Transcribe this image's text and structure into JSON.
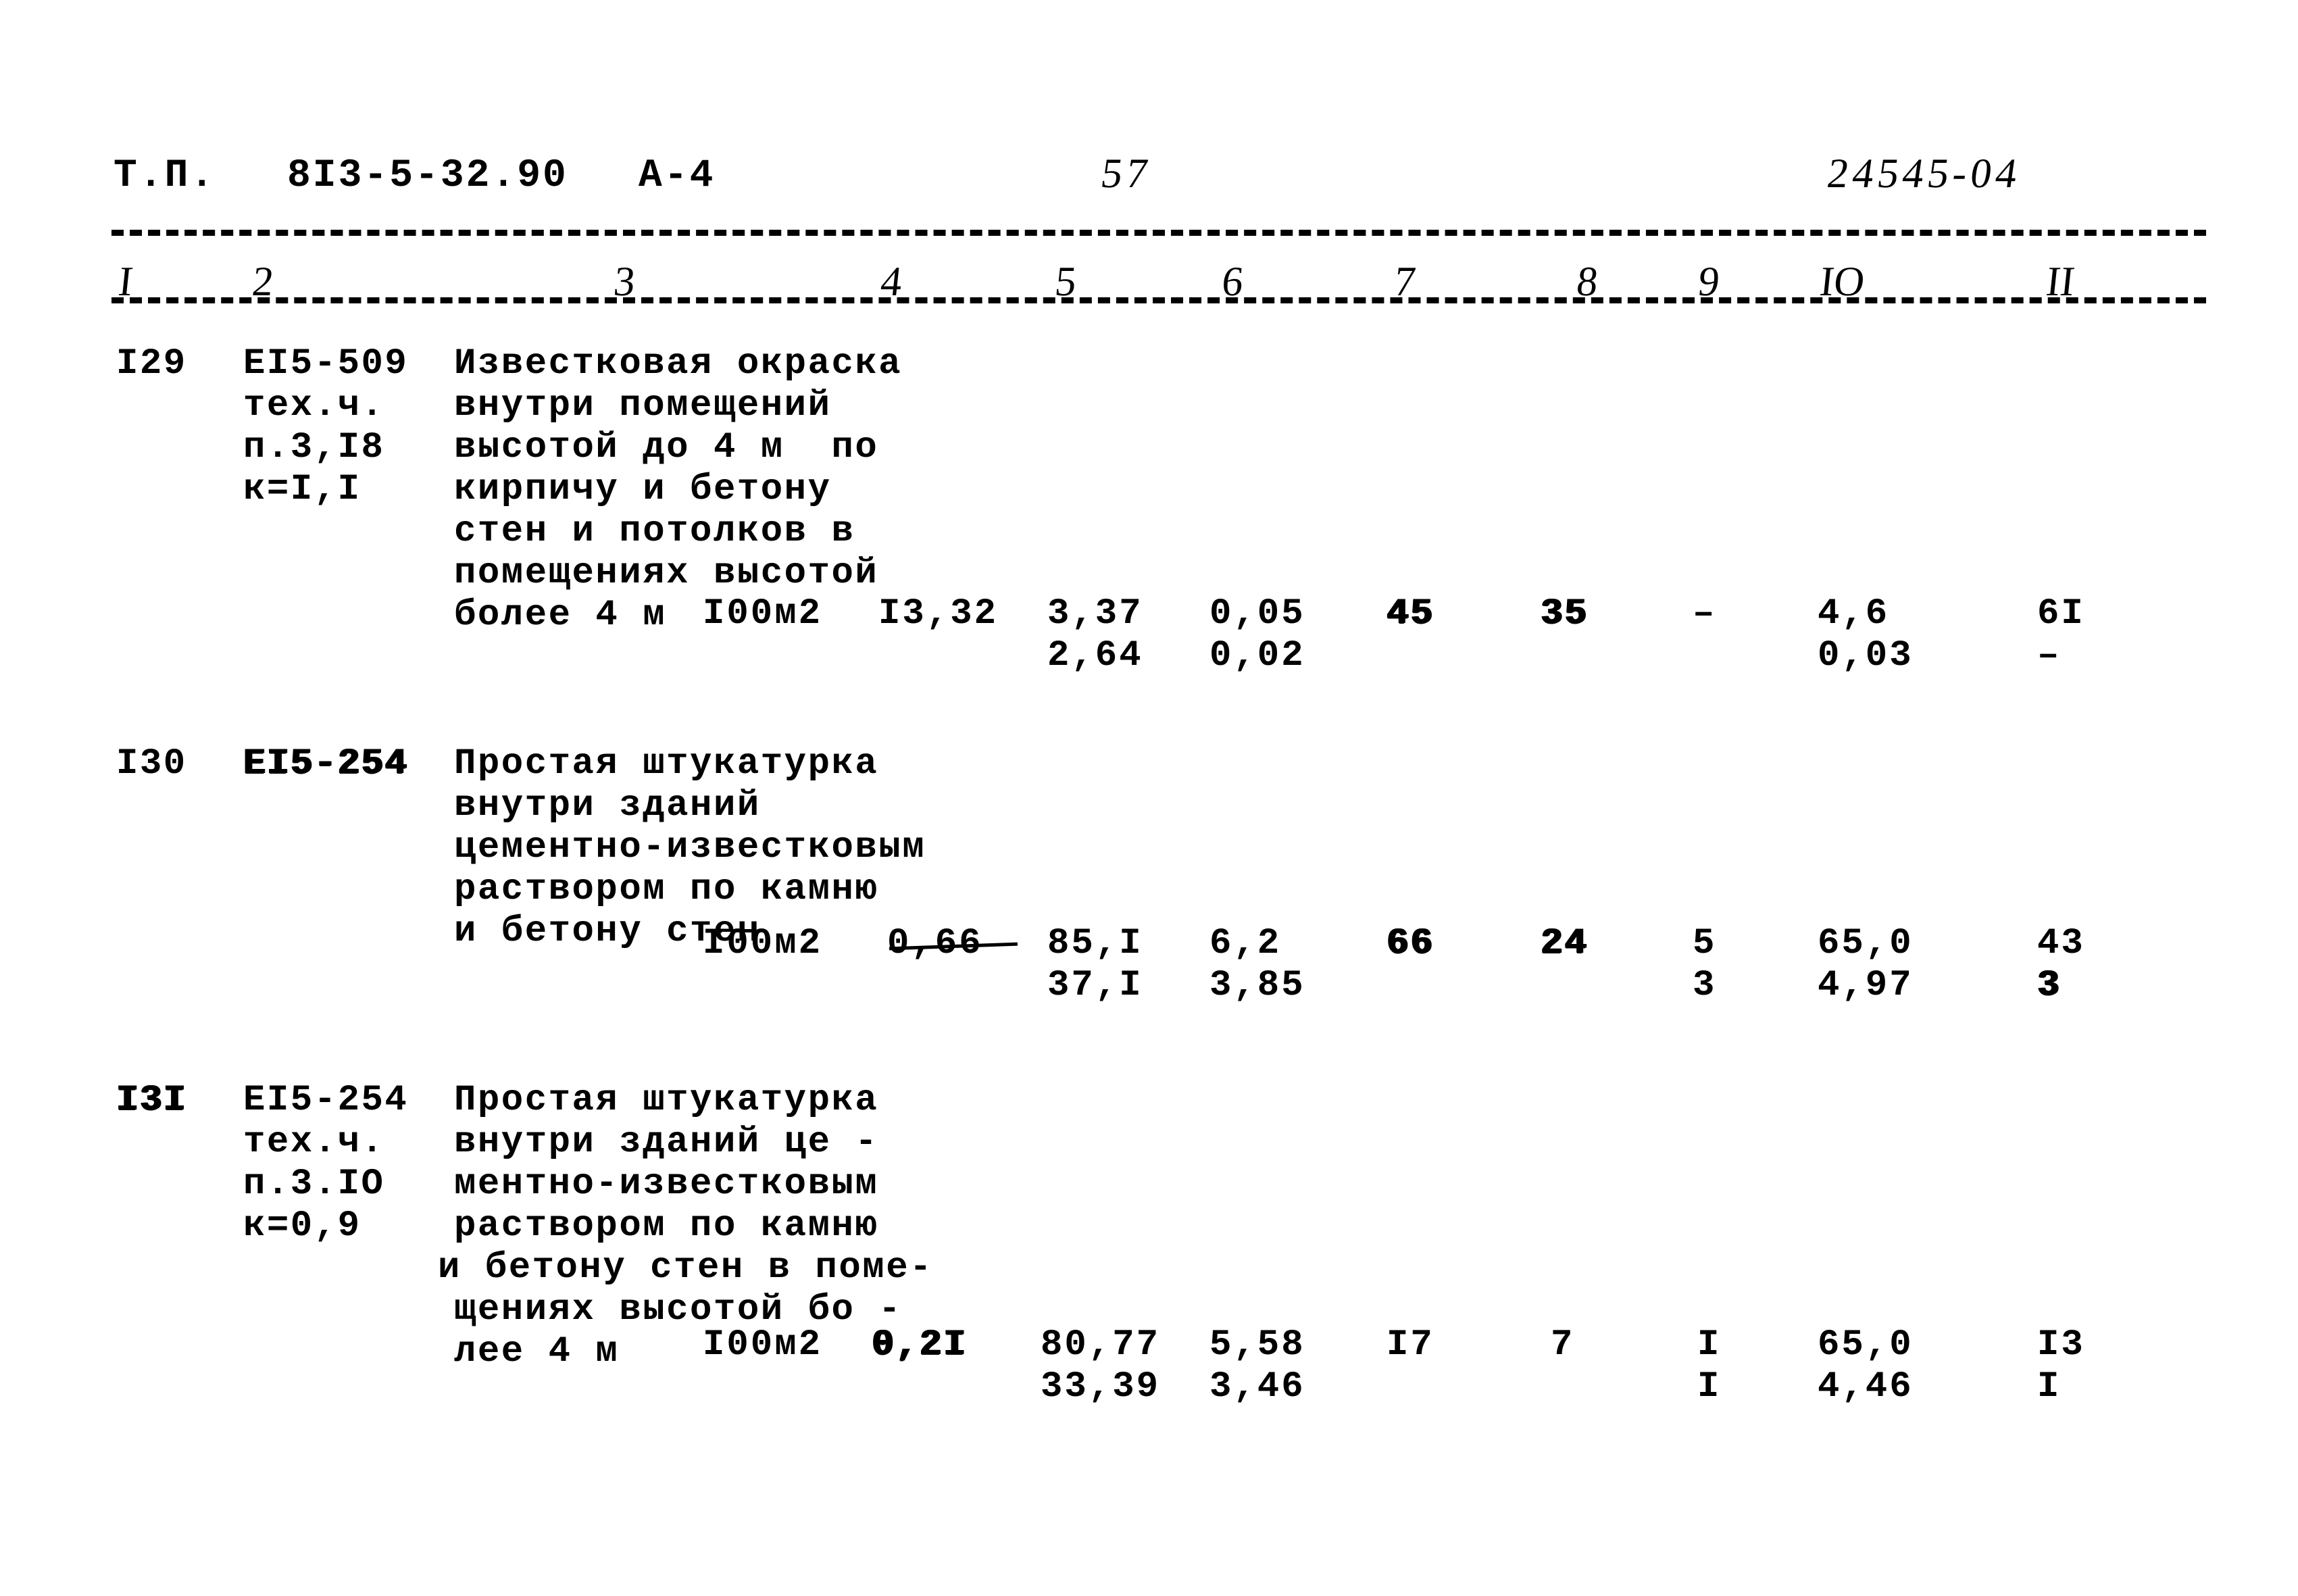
{
  "document": {
    "header": {
      "doc_type": "Т.П.",
      "series": "8I3-5-32.90",
      "section": "А-4",
      "page_number": "57",
      "archive_code": "24545-04"
    },
    "column_numbers": [
      "I",
      "2",
      "3",
      "4",
      "5",
      "6",
      "7",
      "8",
      "9",
      "IO",
      "II"
    ],
    "rows": [
      {
        "num": "I29",
        "num_bold": false,
        "code": "ЕI5-509",
        "code_bold": false,
        "code_notes": [
          "тех.ч.",
          "п.3,I8",
          "к=I,I"
        ],
        "description": [
          "Известковая окраска",
          "внутри помещений",
          "высотой до 4 м  по",
          "кирпичу и бетону",
          "стен и потолков в",
          "помещениях высотой",
          "более 4 м"
        ],
        "unit": "I00м2",
        "quantity": "I3,32",
        "quantity_struck": false,
        "col5": [
          "3,37",
          "2,64"
        ],
        "col6": [
          "0,05",
          "0,02"
        ],
        "col7": "45",
        "col7_bold": true,
        "col8": "35",
        "col8_bold": true,
        "col9": [
          "–"
        ],
        "col10": [
          "4,6",
          "0,03"
        ],
        "col11": [
          "6I",
          "–"
        ]
      },
      {
        "num": "I30",
        "num_bold": false,
        "code": "ЕI5-254",
        "code_bold": true,
        "code_notes": [],
        "description": [
          "Простая штукатурка",
          "внутри зданий",
          "цементно-известковым",
          "раствором по камню",
          "и бетону стен"
        ],
        "unit": "I00м2",
        "quantity": "0,66",
        "quantity_struck": true,
        "col5": [
          "85,I",
          "37,I"
        ],
        "col6": [
          "6,2",
          "3,85"
        ],
        "col7": "66",
        "col7_bold": true,
        "col8": "24",
        "col8_bold": true,
        "col9": [
          "5",
          "3"
        ],
        "col10": [
          "65,0",
          "4,97"
        ],
        "col11": [
          "43",
          "3"
        ]
      },
      {
        "num": "I3I",
        "num_bold": true,
        "code": "ЕI5-254",
        "code_bold": false,
        "code_notes": [
          "тех.ч.",
          "п.3.IO",
          "к=0,9"
        ],
        "description": [
          "Простая штукатурка",
          "внутри зданий це -",
          "ментно-известковым",
          "раствором по камню",
          "и бетону стен в поме-",
          "щениях высотой бо -",
          "лее 4 м"
        ],
        "unit": "I00м2",
        "quantity": "0,2I",
        "quantity_bold": true,
        "quantity_struck": false,
        "col5": [
          "80,77",
          "33,39"
        ],
        "col6": [
          "5,58",
          "3,46"
        ],
        "col7": "I7",
        "col7_bold": false,
        "col8": "7",
        "col8_bold": false,
        "col9": [
          "I",
          "I"
        ],
        "col10": [
          "65,0",
          "4,46"
        ],
        "col11": [
          "I3",
          "I"
        ]
      }
    ]
  }
}
